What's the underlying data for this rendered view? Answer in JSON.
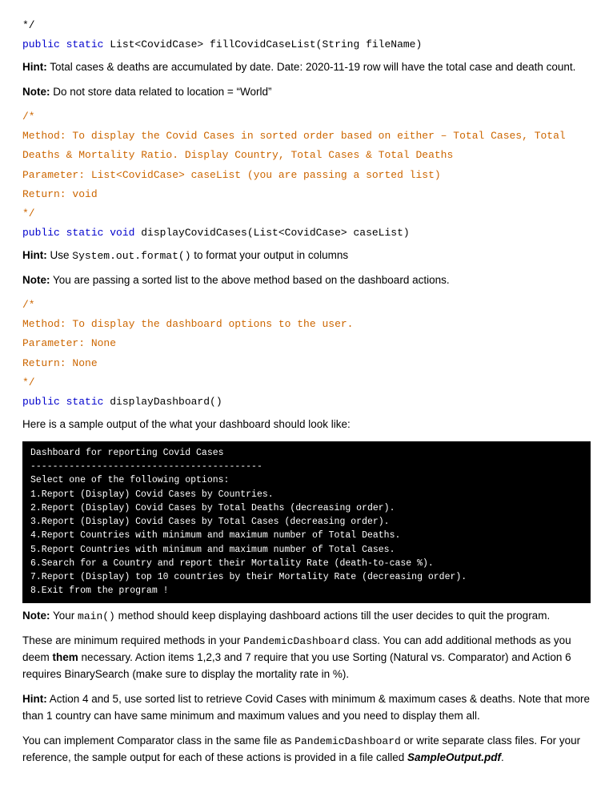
{
  "content": {
    "line_comment_end": "*/",
    "method1_signature": "public static List<CovidCase> fillCovidCaseList(String fileName)",
    "hint1_label": "Hint:",
    "hint1_text": " Total cases & deaths are accumulated by date. Date: 2020-11-19 row will have the total case and death count.",
    "note1_label": "Note:",
    "note1_text": " Do not store data related to location = “World”",
    "comment2_lines": [
      "/*",
      "Method: To display the Covid Cases in sorted order based on either – Total Cases, Total",
      "Deaths & Mortality Ratio. Display Country, Total Cases & Total Deaths",
      "Parameter: List<CovidCase> caseList (you are passing a sorted list)",
      "Return: void",
      "*/"
    ],
    "method2_signature": "public static void displayCovidCases(List<CovidCase> caseList)",
    "hint2_label": "Hint:",
    "hint2_text": " Use System.out.format() to format your output in columns",
    "note2_label": "Note:",
    "note2_text": " You are passing a sorted list to the above method based on the dashboard actions.",
    "comment3_lines": [
      "/*",
      "Method: To display the dashboard options to the user.",
      "Parameter: None",
      "Return: None",
      "*/"
    ],
    "method3_signature": "public static displayDashboard()",
    "sample_intro": "Here is a sample output of the what your dashboard should look like:",
    "terminal_content": "Dashboard for reporting Covid Cases\n------------------------------------------\nSelect one of the following options:\n1.Report (Display) Covid Cases by Countries.\n2.Report (Display) Covid Cases by Total Deaths (decreasing order).\n3.Report (Display) Covid Cases by Total Cases (decreasing order).\n4.Report Countries with minimum and maximum number of Total Deaths.\n5.Report Countries with minimum and maximum number of Total Cases.\n6.Search for a Country and report their Mortality Rate (death-to-case %).\n7.Report (Display) top 10 countries by their Mortality Rate (decreasing order).\n8.Exit from the program !",
    "note3_label": "Note:",
    "note3_text_pre": " Your ",
    "note3_code": "main()",
    "note3_text_post": " method  should keep displaying dashboard actions till the user decides to quit the program.",
    "para1": "These are minimum required methods in your ",
    "para1_code": "PandemicDashboard",
    "para1_cont": " class.  You can add additional methods as you deem ",
    "para1_bold": "them",
    "para1_cont2": " necessary. Action items 1,2,3 and 7 require that you use Sorting (Natural vs. Comparator) and Action 6 requires BinarySearch (make sure to display the mortality rate in %).",
    "hint3_label": "Hint:",
    "hint3_text": " Action 4 and 5, use sorted list to retrieve Covid Cases with minimum & maximum cases & deaths. Note that more than 1 country can have same minimum and maximum values and you need to display them all.",
    "para2_start": "You can implement Comparator class in the same file as ",
    "para2_code": "PandemicDashboard",
    "para2_cont": "  or write separate class files. For your reference, the sample output for each of these actions is provided in a file called ",
    "para2_italic": "SampleOutput.pdf",
    "para2_end": "."
  }
}
